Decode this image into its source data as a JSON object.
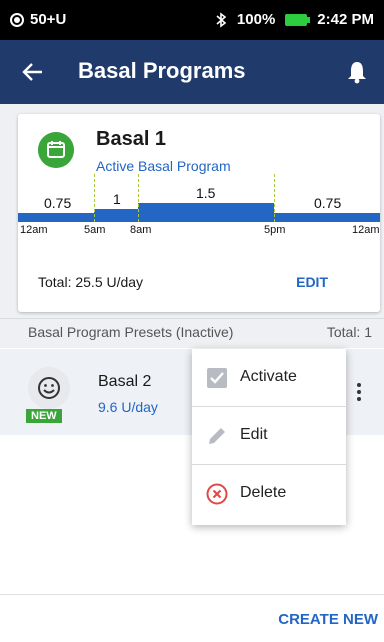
{
  "status_bar": {
    "carrier": "50+U",
    "battery": "100%",
    "time": "2:42 PM",
    "icons": [
      "status-dot-icon",
      "bluetooth-icon",
      "battery-icon"
    ]
  },
  "app_bar": {
    "title": "Basal Programs",
    "back_icon": "arrow-left-icon",
    "notification_icon": "bell-icon"
  },
  "active_program": {
    "name": "Basal 1",
    "status": "Active Basal Program",
    "icon": "calendar-icon",
    "total": "Total: 25.5 U/day",
    "edit_label": "EDIT",
    "rate_segments": [
      {
        "label": "0.75",
        "start": "12am",
        "end": "5am",
        "rate": 0.75
      },
      {
        "label": "1",
        "start": "5am",
        "end": "8am",
        "rate": 1
      },
      {
        "label": "1.5",
        "start": "8am",
        "end": "5pm",
        "rate": 1.5
      },
      {
        "label": "0.75",
        "start": "5pm",
        "end": "12am",
        "rate": 0.75
      }
    ],
    "time_labels": [
      "12am",
      "5am",
      "8am",
      "5pm",
      "12am"
    ]
  },
  "presets_section": {
    "header": "Basal Program Presets (Inactive)",
    "total": "Total: 1"
  },
  "preset": {
    "name": "Basal 2",
    "rate": "9.6 U/day",
    "badge": "NEW",
    "icon": "smiley-icon",
    "menu_icon": "more-vertical-icon"
  },
  "context_menu": {
    "items": [
      {
        "label": "Activate",
        "icon": "checkbox-checked-icon"
      },
      {
        "label": "Edit",
        "icon": "pencil-icon"
      },
      {
        "label": "Delete",
        "icon": "delete-circle-icon"
      }
    ]
  },
  "footer": {
    "create_new_label": "CREATE NEW"
  },
  "colors": {
    "app_bar": "#1f3a6b",
    "accent_blue": "#2366c4",
    "green": "#3aa63a",
    "delete_red": "#e04848"
  }
}
